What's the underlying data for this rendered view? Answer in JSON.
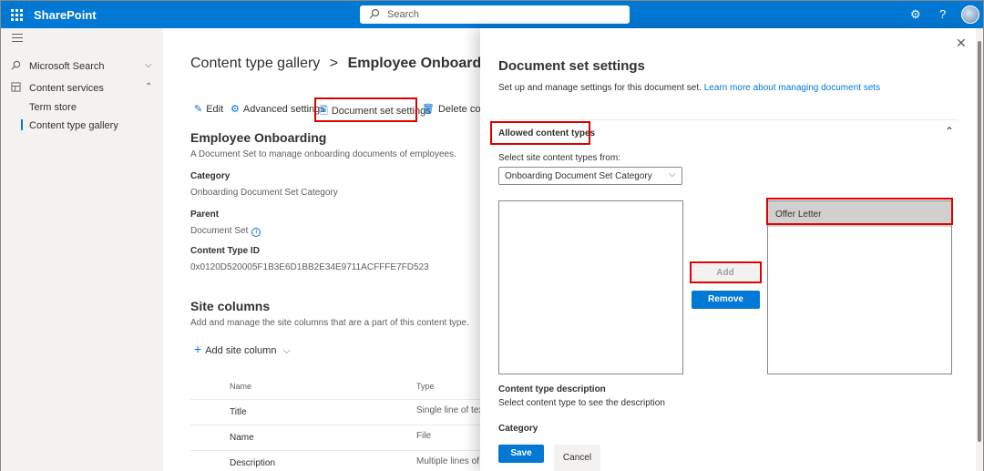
{
  "topbar": {
    "brand": "SharePoint",
    "search_placeholder": "Search"
  },
  "leftnav": {
    "items": [
      {
        "label": "Microsoft Search"
      },
      {
        "label": "Content services"
      }
    ],
    "sub_items": [
      {
        "label": "Term store"
      },
      {
        "label": "Content type gallery"
      }
    ]
  },
  "main": {
    "breadcrumb_parent": "Content type gallery",
    "breadcrumb_separator": ">",
    "breadcrumb_current": "Employee Onboarding",
    "commands": {
      "edit": "Edit",
      "advanced": "Advanced settings",
      "docset": "Document set settings",
      "delete": "Delete conte"
    },
    "title": "Employee Onboarding",
    "description": "A Document Set to manage onboarding documents of employees.",
    "category_label": "Category",
    "category_value": "Onboarding Document Set Category",
    "parent_label": "Parent",
    "parent_value": "Document Set",
    "ctid_label": "Content Type ID",
    "ctid_value": "0x0120D520005F1B3E6D1BB2E34E9711ACFFFE7FD523",
    "site_columns_title": "Site columns",
    "site_columns_sub": "Add and manage the site columns that are a part of this content type.",
    "add_site_column": "Add site column",
    "table": {
      "headers": [
        "Name",
        "Type"
      ],
      "rows": [
        {
          "name": "Title",
          "type": "Single line of text"
        },
        {
          "name": "Name",
          "type": "File"
        },
        {
          "name": "Description",
          "type": "Multiple lines of t"
        }
      ]
    }
  },
  "panel": {
    "title": "Document set settings",
    "subtitle": "Set up and manage settings for this document set.",
    "learn_more": "Learn more about managing document sets",
    "section": "Allowed content types",
    "select_label": "Select site content types from:",
    "dropdown_value": "Onboarding Document Set Category",
    "selected_items": [
      "Offer Letter"
    ],
    "add_label": "Add",
    "remove_label": "Remove",
    "desc_label": "Content type description",
    "desc_text": "Select content type to see the description",
    "category_label": "Category",
    "save_label": "Save",
    "cancel_label": "Cancel"
  },
  "colors": {
    "accent": "#0078d4",
    "highlight": "#dd0000"
  }
}
